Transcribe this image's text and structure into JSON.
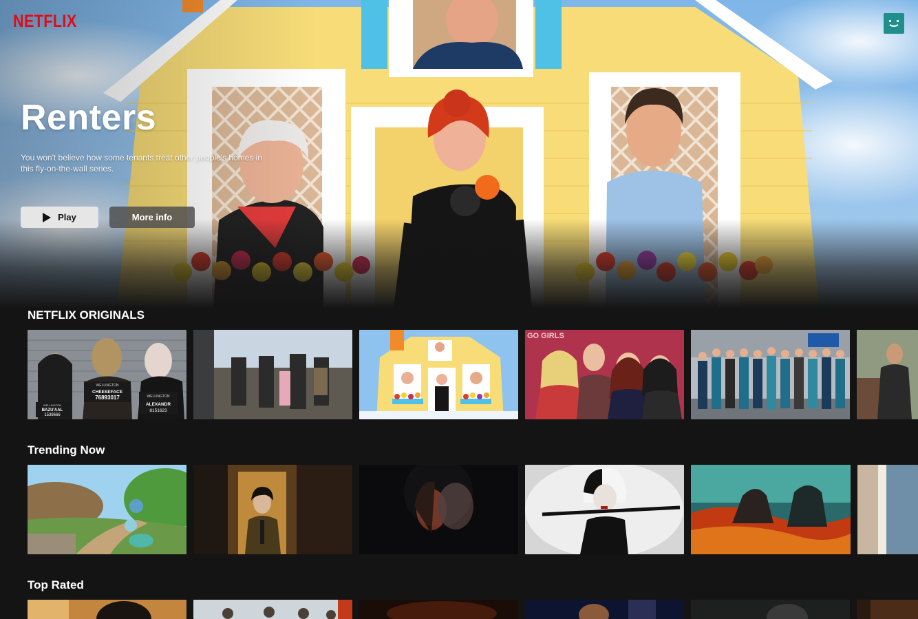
{
  "brand": {
    "logo_text": "NETFLIX",
    "logo_color": "#e50914"
  },
  "profile": {
    "avatar_color": "#1f8f8c"
  },
  "hero": {
    "title": "Renters",
    "description": "You won't believe how some tenants treat other people's homes in this fly-on-the-wall series.",
    "play_label": "Play",
    "info_label": "More info"
  },
  "rows": [
    {
      "title": "NETFLIX ORIGINALS",
      "tiles": [
        {
          "name": "wellington-paranormal",
          "texts": [
            "WELLINGTON",
            "CHEESEFACE",
            "76893017",
            "WELLINGTON",
            "BAZU'AAL",
            "1538666",
            "WELLINGTON",
            "ALEXANDR",
            "8151623"
          ]
        },
        {
          "name": "farm-group-show",
          "texts": []
        },
        {
          "name": "renters",
          "texts": []
        },
        {
          "name": "go-girls",
          "texts": [
            "GO GIRLS"
          ]
        },
        {
          "name": "shortland-street",
          "texts": []
        },
        {
          "name": "action-show",
          "texts": []
        }
      ]
    },
    {
      "title": "Trending Now",
      "tiles": [
        {
          "name": "luca",
          "texts": []
        },
        {
          "name": "loki",
          "texts": []
        },
        {
          "name": "thriller-couple",
          "texts": []
        },
        {
          "name": "cruella",
          "texts": []
        },
        {
          "name": "godzilla-vs-kong",
          "texts": []
        },
        {
          "name": "partial-tile",
          "texts": []
        }
      ]
    },
    {
      "title": "Top Rated",
      "tiles": [
        {
          "name": "top-rated-1",
          "texts": []
        },
        {
          "name": "top-rated-2",
          "texts": []
        },
        {
          "name": "top-rated-3",
          "texts": []
        },
        {
          "name": "top-rated-4",
          "texts": []
        },
        {
          "name": "top-rated-5",
          "texts": []
        },
        {
          "name": "top-rated-6",
          "texts": []
        }
      ]
    }
  ]
}
